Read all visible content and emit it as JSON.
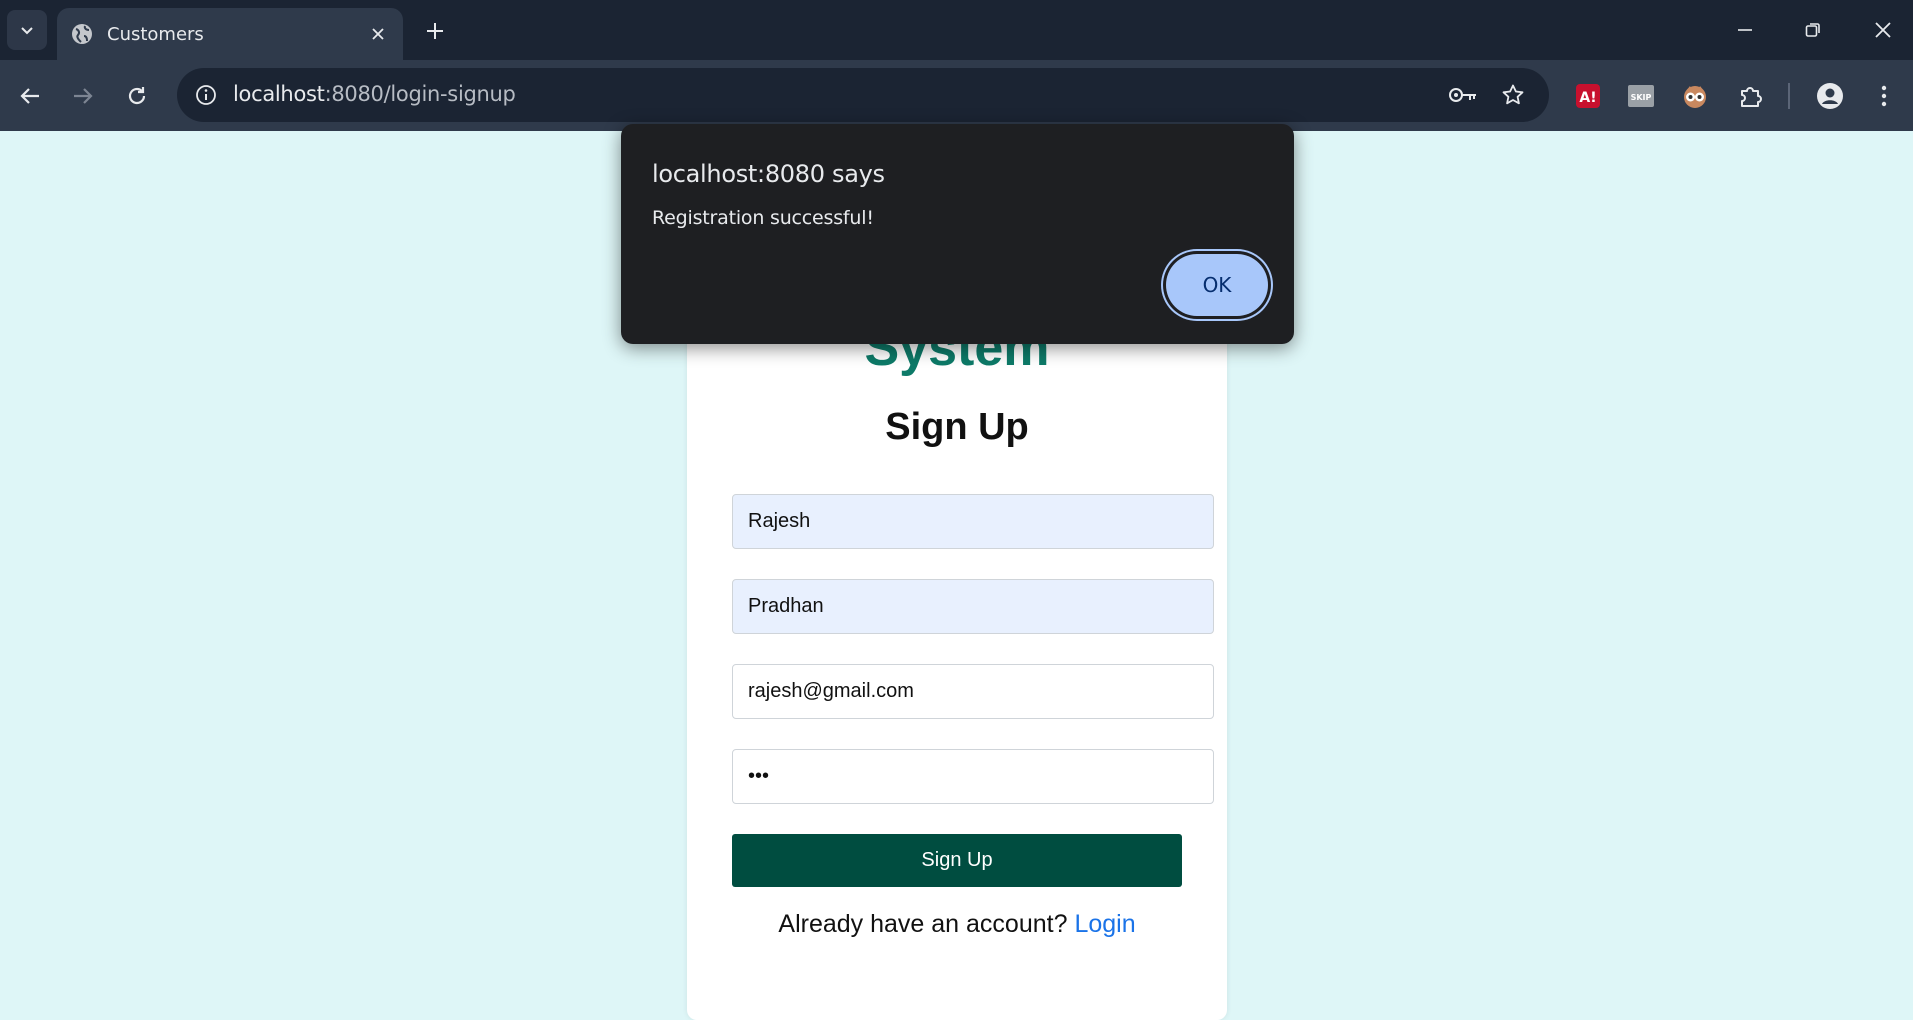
{
  "browser": {
    "tab_title": "Customers",
    "url_host": "localhost",
    "url_rest": ":8080/login-signup",
    "extensions": [
      "adblock-icon",
      "skip-icon",
      "owl-icon",
      "puzzle-icon"
    ],
    "skip_label": "SKIP"
  },
  "page": {
    "app_title_tail": "System",
    "form_title": "Sign Up",
    "fields": [
      {
        "value": "Rajesh"
      },
      {
        "value": "Pradhan"
      },
      {
        "value": "rajesh@gmail.com"
      },
      {
        "value": "•••"
      }
    ],
    "submit_label": "Sign Up",
    "switch_prompt": "Already have an account?",
    "switch_link": "Login",
    "colors": {
      "background": "#def6f7",
      "accent": "#004d40",
      "title": "#0d7a68",
      "link": "#1a73e8"
    }
  },
  "dialog": {
    "title": "localhost:8080 says",
    "message": "Registration successful!",
    "ok_label": "OK"
  }
}
